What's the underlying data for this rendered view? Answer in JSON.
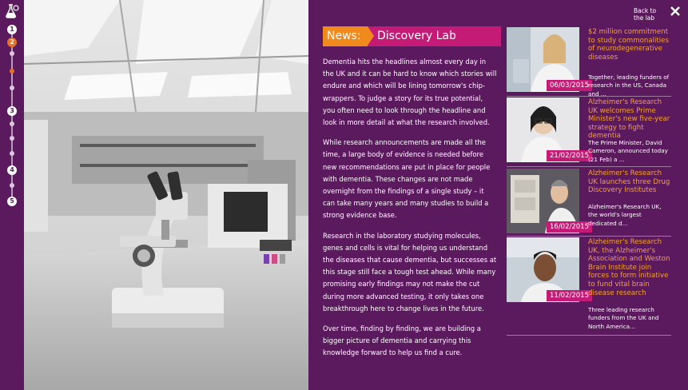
{
  "nav": {
    "steps": [
      {
        "label": "1",
        "active": false
      },
      {
        "label": "2",
        "active": true
      },
      {
        "label": "3",
        "active": false
      },
      {
        "label": "4",
        "active": false
      },
      {
        "label": "5",
        "active": false
      }
    ],
    "icon": "flask-icon"
  },
  "header": {
    "back_label_1": "Back to",
    "back_label_2": "the lab",
    "close_icon": "close-icon"
  },
  "article": {
    "tag": "News:",
    "title": "Discovery Lab",
    "paragraphs": [
      "Dementia hits the headlines almost every day in the UK and it can be hard to know which stories will endure and which will be lining tomorrow's chip-wrappers. To judge a story for its true potential, you often need to look through the headline and look in more detail at what the research involved.",
      "While research announcements are made all the time, a large body of evidence is needed before new recommendations are put in place for people with dementia. These changes are not made overnight from the findings of a single study – it can take many years and many studies to build a strong evidence base.",
      "Research in the laboratory studying molecules, genes and cells is vital for helping us understand the diseases that cause dementia, but successes at this stage still face a tough test ahead. While many promising early findings may not make the cut during more advanced testing, it only takes one breakthrough here to change lives in the future.",
      "Over time, finding by finding, we are building a bigger picture of dementia and carrying this knowledge forward to help us find a cure."
    ]
  },
  "news_items": [
    {
      "date": "06/03/2015",
      "title": "$2 million commitment to study commonalities of neurodegenerative diseases",
      "summary": "Together, leading funders of research in the US, Canada and ..."
    },
    {
      "date": "21/02/2015",
      "title": "Alzheimer's Research UK welcomes Prime Minister's new five-year strategy to fight dementia",
      "summary": "The Prime Minister, David Cameron, announced today (21 Feb) a ..."
    },
    {
      "date": "16/02/2015",
      "title": "Alzheimer's Research UK launches three Drug Discovery Institutes",
      "summary": "Alzheimer's Research UK, the world's largest dedicated d..."
    },
    {
      "date": "11/02/2015",
      "title": "Alzheimer's Research UK, the Alzheimer's Association and Weston Brain Institute join forces to form initiative to fund vital brain disease research",
      "summary": "Three leading research funders from the UK and North America..."
    }
  ],
  "colors": {
    "background": "#5c1a5e",
    "accent_orange": "#f08a1c",
    "accent_magenta": "#c41b77",
    "headline": "#f3a235"
  }
}
